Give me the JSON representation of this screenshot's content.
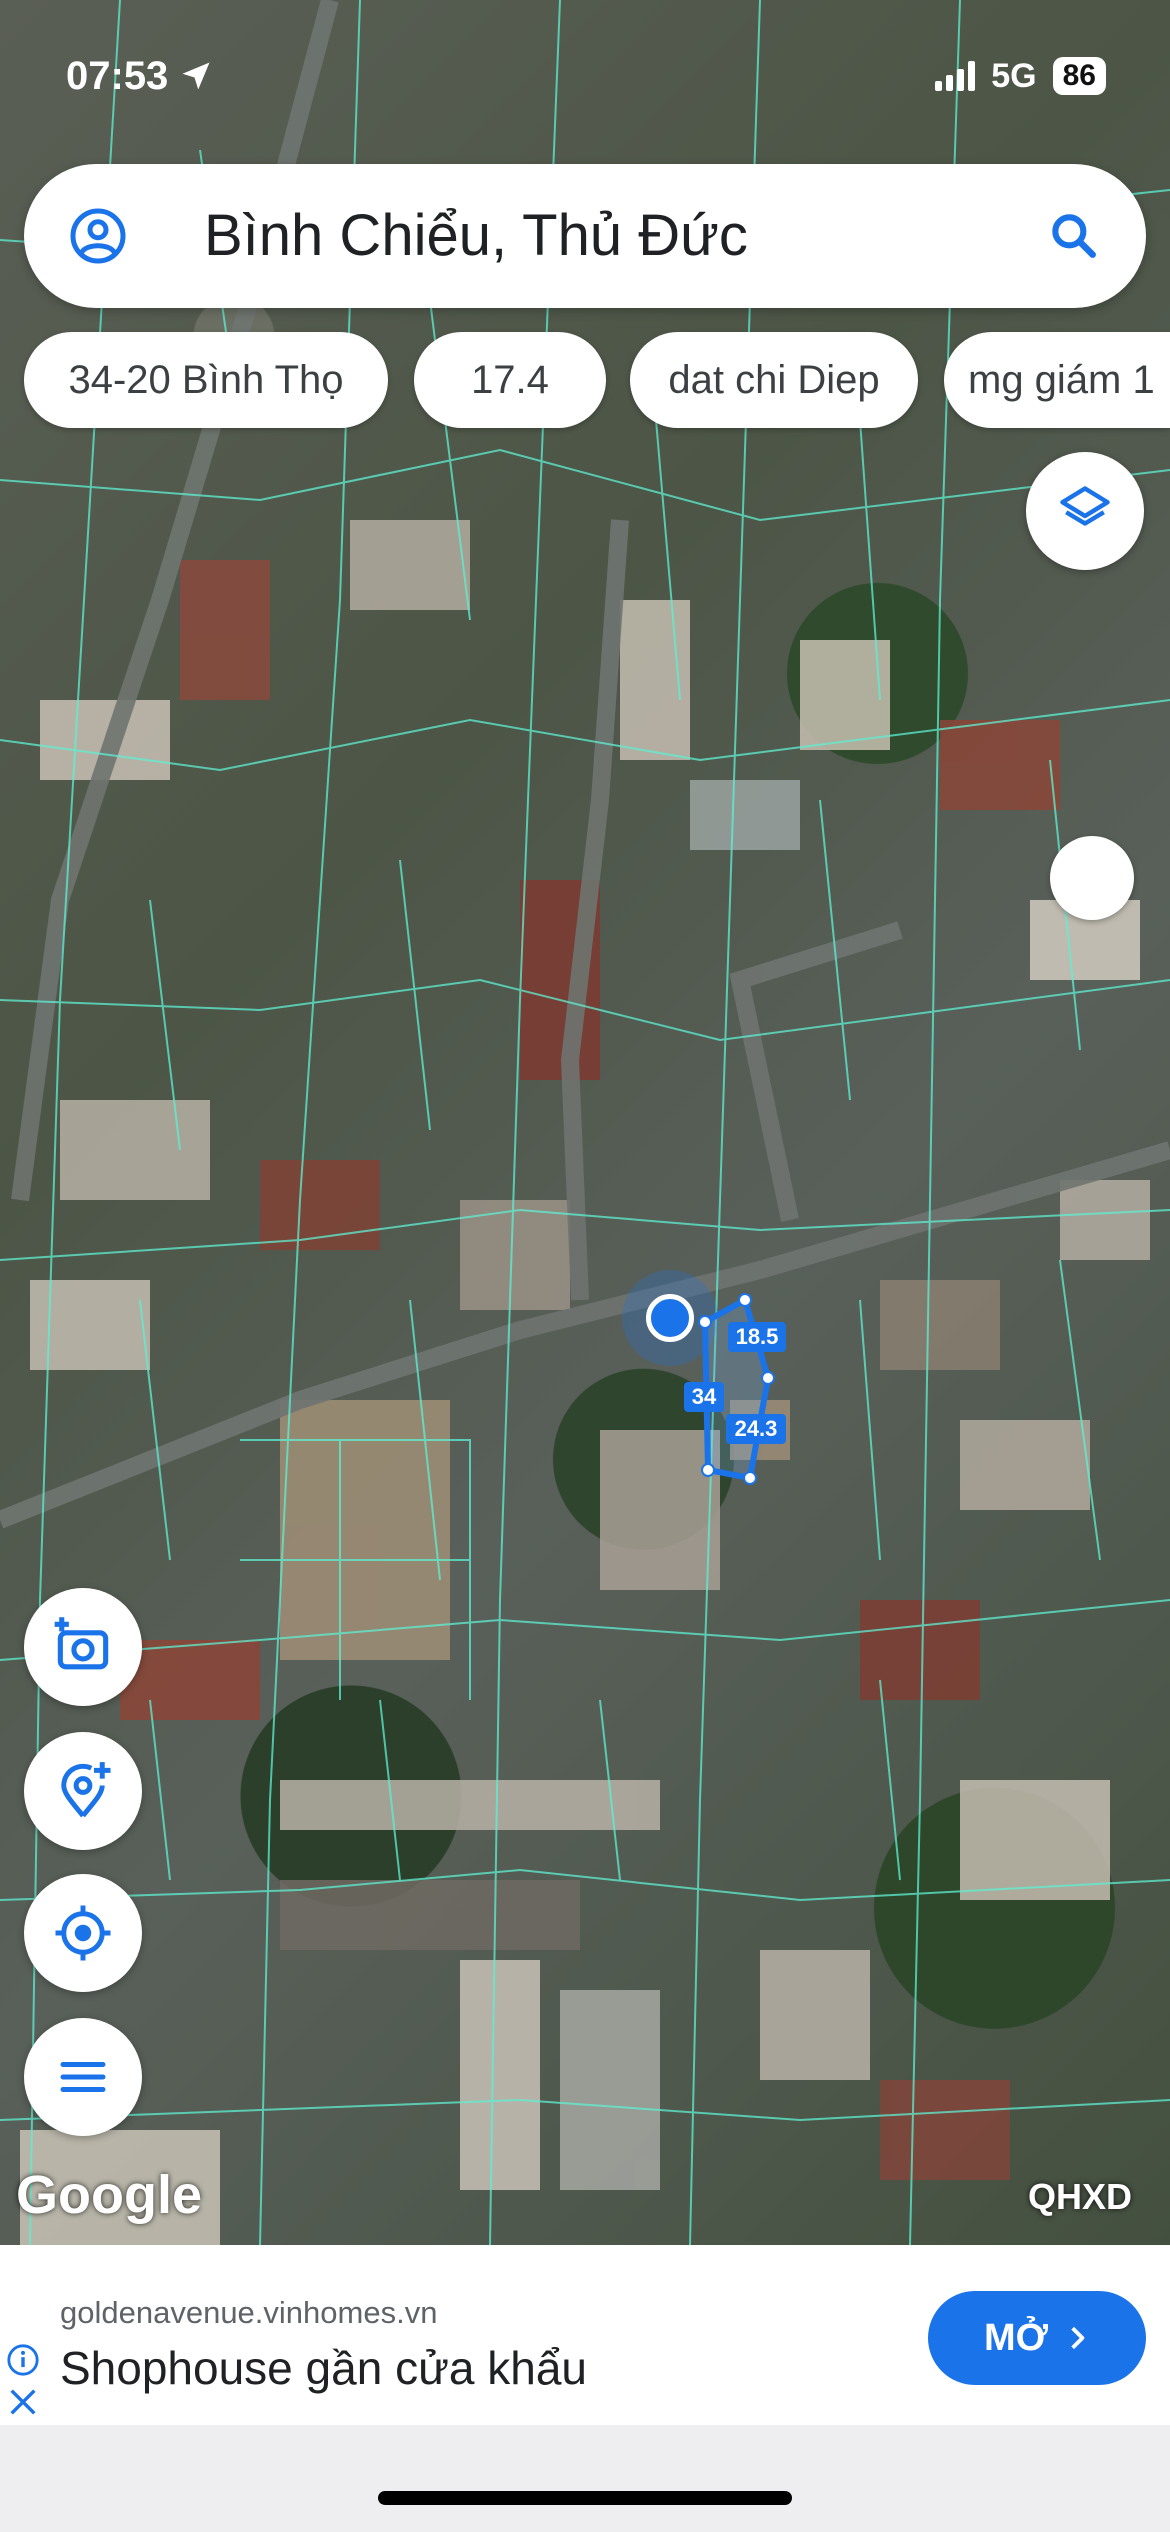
{
  "status_bar": {
    "time": "07:53",
    "network": "5G",
    "battery": "86"
  },
  "search": {
    "query": "Bình Chiểu, Thủ Đức",
    "account_icon": "account-circle-icon",
    "search_icon": "search-icon"
  },
  "chips": [
    "34-20 Bình Thọ",
    "17.4",
    "dat chi Diep",
    "mg giám 1"
  ],
  "map": {
    "parcel": {
      "top_label": "18.5",
      "left_label": "34",
      "right_label": "24.3"
    },
    "accent_color": "#1a73e8",
    "boundary_color": "#5ef0d2"
  },
  "controls": {
    "layers_icon": "layers-icon",
    "camera_icon": "add-photo-icon",
    "add_place_icon": "add-location-icon",
    "my_location_icon": "my-location-icon",
    "menu_icon": "menu-icon"
  },
  "watermark": {
    "google": "Google",
    "layer": "QHXD"
  },
  "ad": {
    "domain": "goldenavenue.vinhomes.vn",
    "headline": "Shophouse gần cửa khẩu",
    "button": "MỞ"
  }
}
